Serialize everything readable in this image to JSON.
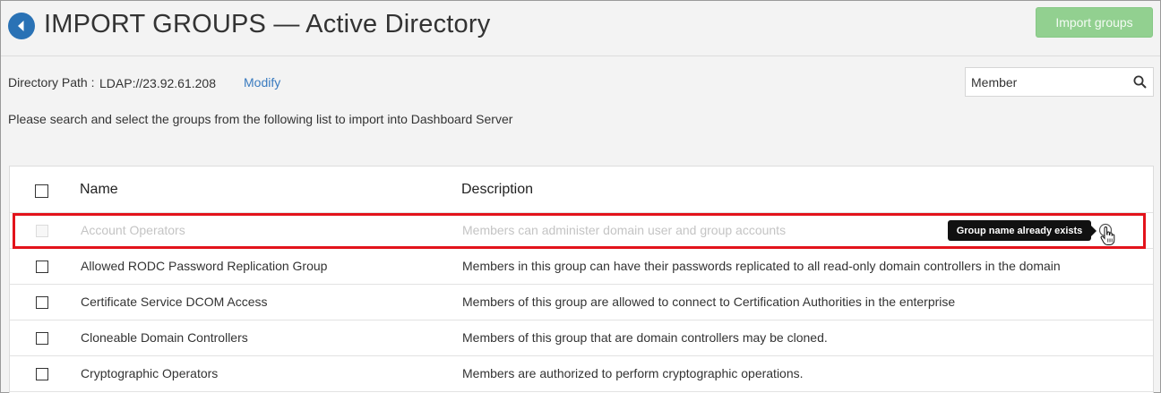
{
  "header": {
    "back_icon": "back-arrow-icon",
    "title": "IMPORT GROUPS  —  Active Directory",
    "import_button": "Import groups"
  },
  "directory": {
    "label": "Directory Path :",
    "value": "LDAP://23.92.61.208",
    "modify_link": "Modify"
  },
  "search": {
    "value": "Member",
    "placeholder": "Search",
    "icon": "search-icon"
  },
  "instruction": "Please search and select the groups from the following list to import into Dashboard Server",
  "table": {
    "columns": [
      "Name",
      "Description"
    ],
    "rows": [
      {
        "name": "Account Operators",
        "description": "Members can administer domain user and group accounts",
        "disabled": true
      },
      {
        "name": "Allowed RODC Password Replication Group",
        "description": "Members in this group can have their passwords replicated to all read-only domain controllers in the domain",
        "disabled": false
      },
      {
        "name": "Certificate Service DCOM Access",
        "description": "Members of this group are allowed to connect to Certification Authorities in the enterprise",
        "disabled": false
      },
      {
        "name": "Cloneable Domain Controllers",
        "description": "Members of this group that are domain controllers may be cloned.",
        "disabled": false
      },
      {
        "name": "Cryptographic Operators",
        "description": "Members are authorized to perform cryptographic operations.",
        "disabled": false
      }
    ]
  },
  "tooltip": {
    "text": "Group name already exists",
    "icon": "info-icon"
  },
  "colors": {
    "accent_blue": "#2a72b5",
    "import_button_green": "#92d090",
    "highlight_red": "#e3131b",
    "link_blue": "#3a7bbf"
  }
}
